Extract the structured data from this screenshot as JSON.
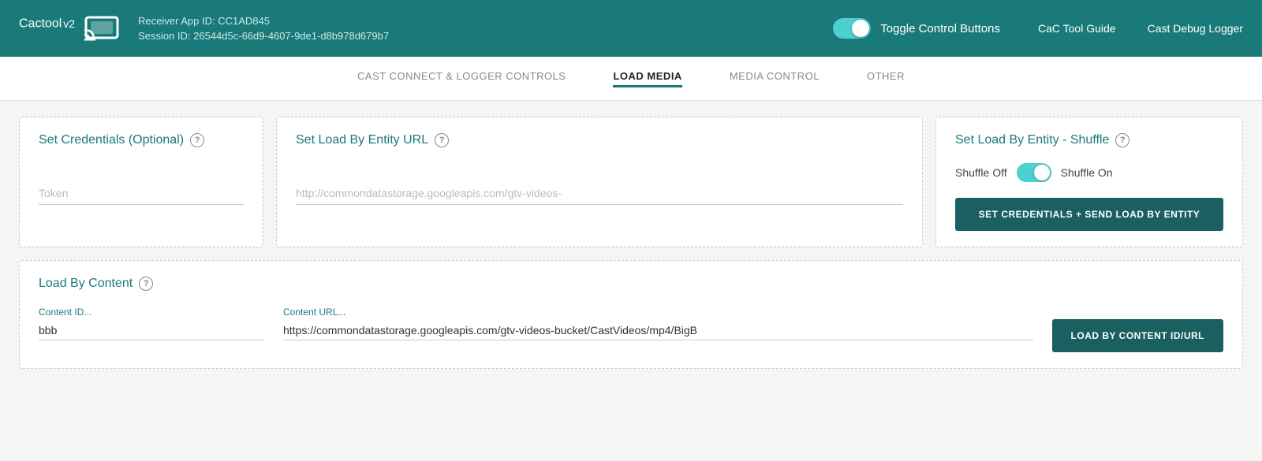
{
  "header": {
    "logo_text": "Cactool",
    "logo_version": "v2",
    "receiver_app_id_label": "Receiver App ID: CC1AD845",
    "session_id_label": "Session ID: 26544d5c-66d9-4607-9de1-d8b978d679b7",
    "toggle_label": "Toggle Control Buttons",
    "link_guide": "CaC Tool Guide",
    "link_logger": "Cast Debug Logger"
  },
  "tabs": [
    {
      "id": "cast-connect",
      "label": "CAST CONNECT & LOGGER CONTROLS",
      "active": false
    },
    {
      "id": "load-media",
      "label": "LOAD MEDIA",
      "active": true
    },
    {
      "id": "media-control",
      "label": "MEDIA CONTROL",
      "active": false
    },
    {
      "id": "other",
      "label": "OTHER",
      "active": false
    }
  ],
  "load_media": {
    "credentials_card": {
      "title": "Set Credentials (Optional)",
      "token_placeholder": "Token"
    },
    "entity_url_card": {
      "title": "Set Load By Entity URL",
      "url_placeholder": "http://commondatastorage.googleapis.com/gtv-videos-"
    },
    "shuffle_card": {
      "title": "Set Load By Entity - Shuffle",
      "shuffle_off_label": "Shuffle Off",
      "shuffle_on_label": "Shuffle On",
      "button_label": "SET CREDENTIALS + SEND LOAD BY ENTITY"
    },
    "content_card": {
      "title": "Load By Content",
      "content_id_label": "Content ID...",
      "content_id_value": "bbb",
      "content_url_label": "Content URL...",
      "content_url_value": "https://commondatastorage.googleapis.com/gtv-videos-bucket/CastVideos/mp4/BigB",
      "button_label": "LOAD BY CONTENT ID/URL"
    }
  }
}
